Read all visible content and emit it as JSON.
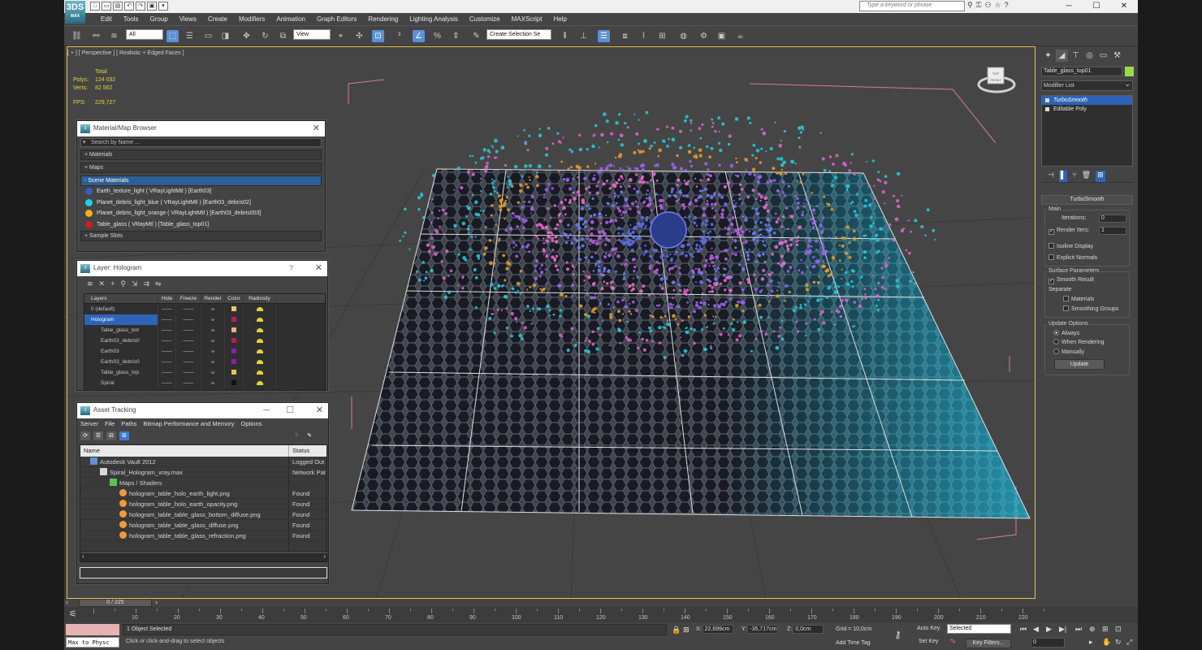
{
  "app": {
    "logo_text": "3DS",
    "logo_sub": "MAX"
  },
  "quick_access": [
    "□",
    "▭",
    "▤",
    "↶",
    "↷",
    "▣",
    "▾"
  ],
  "search": {
    "placeholder": "Type a keyword or phrase"
  },
  "window_controls": [
    "─",
    "☐",
    "✕"
  ],
  "menu": [
    "Edit",
    "Tools",
    "Group",
    "Views",
    "Create",
    "Modifiers",
    "Animation",
    "Graph Editors",
    "Rendering",
    "Lighting Analysis",
    "Customize",
    "MAXScript",
    "Help"
  ],
  "toolbar": {
    "selection_filter": "All",
    "ref_coord": "View",
    "named_selection": "Create Selection Se"
  },
  "viewport": {
    "label": "[ + ] [ Perspective ] [ Realistic + Edged Faces ]",
    "stats": {
      "total_label": "Total",
      "polys_label": "Polys:",
      "polys": "124 032",
      "verts_label": "Verts:",
      "verts": "82 562",
      "fps_label": "FPS:",
      "fps": "229,727"
    },
    "viewcube_top": "TOP",
    "viewcube_front": "FRONT"
  },
  "material_browser": {
    "title": "Material/Map Browser",
    "search_placeholder": "Search by Name ...",
    "sections": {
      "materials": "+ Materials",
      "maps": "+ Maps",
      "scene": "- Scene Materials",
      "sample": "+ Sample Slots"
    },
    "scene_materials": [
      {
        "name": "Earth_texture_light  ( VRayLightMtl )  [Earth03]",
        "color": "#3a5bbf"
      },
      {
        "name": "Planet_debris_light_blue  ( VRayLightMtl )  [Earth03_debris02]",
        "color": "#19d3e6"
      },
      {
        "name": "Planet_debris_light_orange  ( VRayLightMtl )  [Earth03_debris003]",
        "color": "#f0b020"
      },
      {
        "name": "Table_glass  ( VRayMtl )  [Table_glass_top01]",
        "color": "#d01d1d"
      }
    ]
  },
  "layer_panel": {
    "title": "Layer: Hologram",
    "help": "?",
    "tools": [
      "≋",
      "✕",
      "+",
      "⚲",
      "⇲",
      "⇉",
      "⇋"
    ],
    "columns": [
      "Layers",
      "Hide",
      "Freeze",
      "Render",
      "Color",
      "Radiosity"
    ],
    "rows": [
      {
        "name": "0 (default)",
        "color": "#e8c27a",
        "selected": false
      },
      {
        "name": "Hologram",
        "color": "#c0185a",
        "selected": true
      },
      {
        "name": "Table_glass_bot",
        "color": "#e8b27a",
        "selected": false
      },
      {
        "name": "Earth03_debris0",
        "color": "#c0185a",
        "selected": false
      },
      {
        "name": "Earth03",
        "color": "#8a1eb0",
        "selected": false
      },
      {
        "name": "Earth03_debris0",
        "color": "#8a1eb0",
        "selected": false
      },
      {
        "name": "Table_glass_top",
        "color": "#e8c24a",
        "selected": false
      },
      {
        "name": "Spiral",
        "color": "#111111",
        "selected": false
      }
    ],
    "dashes": "——"
  },
  "asset_tracking": {
    "title": "Asset Tracking",
    "menu": [
      "Server",
      "File",
      "Paths",
      "Bitmap Performance and Memory",
      "Options"
    ],
    "columns": [
      "Name",
      "Status"
    ],
    "rows": [
      {
        "name": "Autodesk Vault 2012",
        "status": "Logged Out",
        "indent": 1,
        "icon": "vault"
      },
      {
        "name": "Spiral_Hologram_vray.max",
        "status": "Network Pat",
        "indent": 2,
        "icon": "file"
      },
      {
        "name": "Maps / Shaders",
        "status": "",
        "indent": 3,
        "icon": "folder"
      },
      {
        "name": "hologram_table_holo_earth_light.png",
        "status": "Found",
        "indent": 4,
        "icon": "png"
      },
      {
        "name": "hologram_table_holo_earth_opacity.png",
        "status": "Found",
        "indent": 4,
        "icon": "png"
      },
      {
        "name": "hologram_table_table_glass_bottom_diffuse.png",
        "status": "Found",
        "indent": 4,
        "icon": "png"
      },
      {
        "name": "hologram_table_table_glass_diffuse.png",
        "status": "Found",
        "indent": 4,
        "icon": "png"
      },
      {
        "name": "hologram_table_table_glass_refraction.png",
        "status": "Found",
        "indent": 4,
        "icon": "png"
      }
    ]
  },
  "command_panel": {
    "object_name": "Table_glass_top01",
    "object_color": "#9bdb48",
    "modifier_list": "Modifier List",
    "stack": [
      {
        "name": "TurboSmooth",
        "active": true
      },
      {
        "name": "Editable Poly",
        "active": false
      }
    ],
    "turbosmooth": {
      "header": "TurboSmooth",
      "main": "Main",
      "iterations_label": "Iterations:",
      "iterations": "0",
      "render_iters_label": "Render Iters:",
      "render_iters": "1",
      "isoline": "Isoline Display",
      "explicit": "Explicit Normals",
      "surface_params": "Surface Parameters",
      "smooth_result": "Smooth Result",
      "separate": "Separate",
      "materials": "Materials",
      "smoothing_groups": "Smoothing Groups",
      "update_options": "Update Options",
      "always": "Always",
      "when_rendering": "When Rendering",
      "manually": "Manually",
      "update": "Update"
    }
  },
  "timeline": {
    "slider": "0 / 225",
    "ticks": [
      10,
      20,
      30,
      40,
      50,
      60,
      70,
      80,
      90,
      100,
      110,
      120,
      130,
      140,
      150,
      160,
      170,
      180,
      190,
      200,
      210,
      220
    ]
  },
  "status": {
    "selected": "1 Object Selected",
    "hint": "Click or click-and-drag to select objects",
    "maxscript": "Max to Physc",
    "x_label": "X:",
    "x": "22,699cm",
    "y_label": "Y:",
    "y": "-35,717cm",
    "z_label": "Z:",
    "z": "0,0cm",
    "grid": "Grid = 10,0cm",
    "add_time_tag": "Add Time Tag",
    "auto_key": "Auto Key",
    "set_key": "Set Key",
    "selected_dropdown": "Selected",
    "key_filters": "Key Filters...",
    "frame": "0"
  }
}
